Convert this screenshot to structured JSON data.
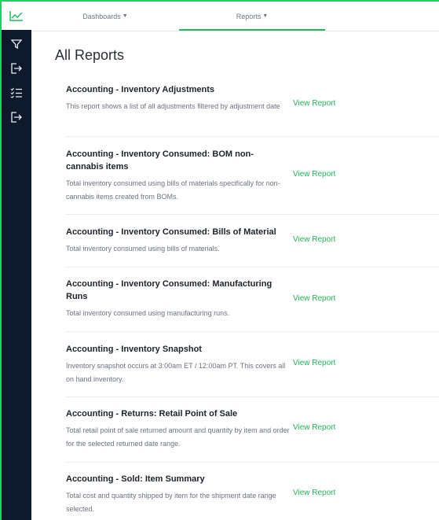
{
  "nav": {
    "tabs": [
      {
        "label": "Dashboards"
      },
      {
        "label": "Reports"
      }
    ]
  },
  "page": {
    "title": "All Reports"
  },
  "link_label": "View Report",
  "accent_color": "#24b356",
  "reports": [
    {
      "title": "Accounting - Inventory Adjustments",
      "description": "This report shows a list of all adjustments filtered by adjustment date"
    },
    {
      "title": "Accounting - Inventory Consumed: BOM non-cannabis items",
      "description": "Total inventory consumed using bills of materials specifically for non-cannabis items created from BOMs."
    },
    {
      "title": "Accounting - Inventory Consumed: Bills of Material",
      "description": "Total inventory consumed using bills of materials."
    },
    {
      "title": "Accounting - Inventory Consumed: Manufacturing Runs",
      "description": "Total inventory consumed using manufacturing runs."
    },
    {
      "title": "Accounting - Inventory Snapshot",
      "description": "Inventory snapshot occurs at 3:00am ET / 12:00am PT. This covers all on hand inventory."
    },
    {
      "title": "Accounting - Returns: Retail Point of Sale",
      "description": "Total retail point of sale returned amount and quantity by item and order for the selected returned date range."
    },
    {
      "title": "Accounting - Sold: Item Summary",
      "description": "Total cost and quantity shipped by item for the shipment date range selected."
    }
  ],
  "sidebar": {
    "icons": [
      "chart-line-icon",
      "filter-icon",
      "login-icon",
      "checklist-icon",
      "logout-icon"
    ]
  }
}
